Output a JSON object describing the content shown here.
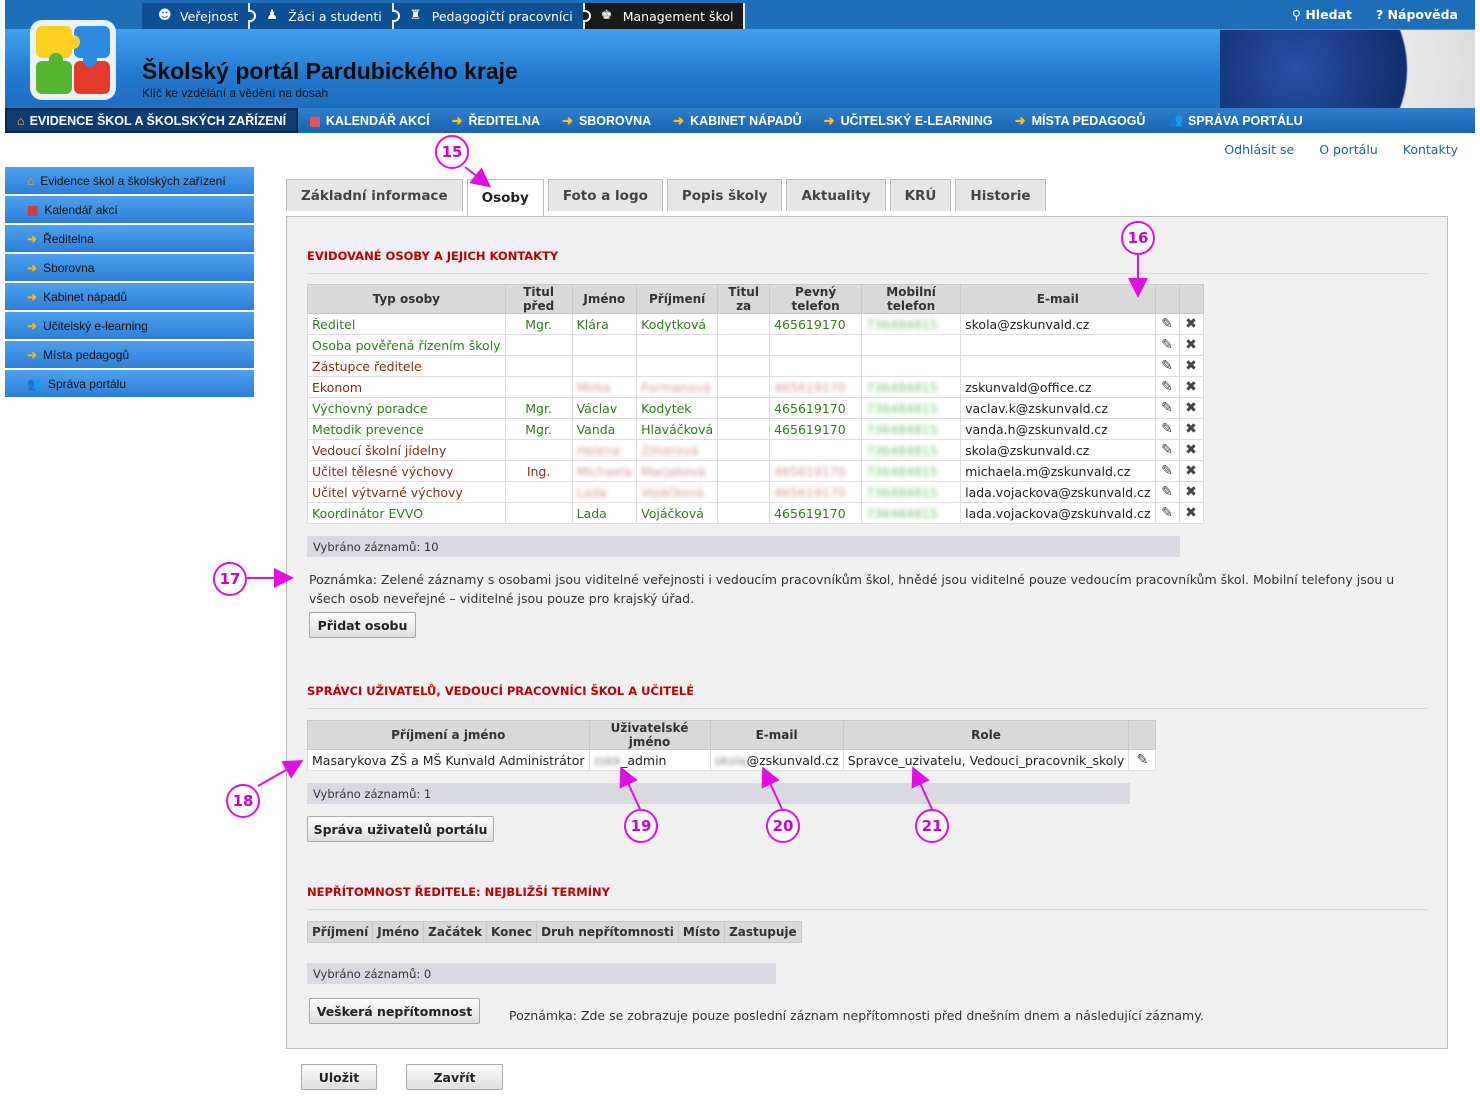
{
  "top": {
    "roles": [
      {
        "label": "Veřejnost",
        "icon": "people-icon"
      },
      {
        "label": "Žáci a studenti",
        "icon": "student-icon"
      },
      {
        "label": "Pedagogičtí pracovníci",
        "icon": "teacher-icon"
      },
      {
        "label": "Management škol",
        "icon": "manager-icon"
      }
    ],
    "search": "Hledat",
    "help": "Nápověda"
  },
  "banner": {
    "title": "Školský portál Pardubického kraje",
    "subtitle": "Klíč ke vzdělání a vědění na dosah"
  },
  "mainnav": [
    "EVIDENCE ŠKOL A ŠKOLSKÝCH ZAŘÍZENÍ",
    "KALENDÁŘ AKCÍ",
    "ŘEDITELNA",
    "SBOROVNA",
    "KABINET NÁPADŮ",
    "UČITELSKÝ E-LEARNING",
    "MÍSTA PEDAGOGŮ",
    "SPRÁVA PORTÁLU"
  ],
  "rightlinks": [
    "Odhlásit se",
    "O portálu",
    "Kontakty"
  ],
  "sidebar": [
    "Evidence škol a školských zařízení",
    "Kalendář akcí",
    "Ředitelna",
    "Sborovna",
    "Kabinet nápadů",
    "Učitelský e-learning",
    "Místa pedagogů",
    "Správa portálu"
  ],
  "tabs": [
    "Základní informace",
    "Osoby",
    "Foto a logo",
    "Popis školy",
    "Aktuality",
    "KRÚ",
    "Historie"
  ],
  "persons": {
    "title": "EVIDOVANÉ OSOBY A JEJICH KONTAKTY",
    "headers": [
      "Typ osoby",
      "Titul před",
      "Jméno",
      "Příjmení",
      "Titul za",
      "Pevný telefon",
      "Mobilní telefon",
      "E-mail"
    ],
    "rows": [
      {
        "type": "Ředitel",
        "tp": "Mgr.",
        "first": "Klára",
        "last": "Kodytková",
        "tz": "",
        "phone": "465619170",
        "mobile": "736484815",
        "email": "skola@zskunvald.cz",
        "color": "g"
      },
      {
        "type": "Osoba pověřená řízením školy",
        "tp": "",
        "first": "",
        "last": "",
        "tz": "",
        "phone": "",
        "mobile": "",
        "email": "",
        "color": "g"
      },
      {
        "type": "Zástupce ředitele",
        "tp": "",
        "first": "",
        "last": "",
        "tz": "",
        "phone": "",
        "mobile": "",
        "email": "",
        "color": "b"
      },
      {
        "type": "Ekonom",
        "tp": "",
        "first": "Mirka",
        "last": "Formanová",
        "tz": "",
        "phone": "465619170",
        "mobile": "736484815",
        "email": "zskunvald@office.cz",
        "color": "b"
      },
      {
        "type": "Výchovný poradce",
        "tp": "Mgr.",
        "first": "Václav",
        "last": "Kodytek",
        "tz": "",
        "phone": "465619170",
        "mobile": "736484815",
        "email": "vaclav.k@zskunvald.cz",
        "color": "g"
      },
      {
        "type": "Metodik prevence",
        "tp": "Mgr.",
        "first": "Vanda",
        "last": "Hlaváčková",
        "tz": "",
        "phone": "465619170",
        "mobile": "736484815",
        "email": "vanda.h@zskunvald.cz",
        "color": "g"
      },
      {
        "type": "Vedoucí školní jídelny",
        "tp": "",
        "first": "Helena",
        "last": "Zitterová",
        "tz": "",
        "phone": "",
        "mobile": "736484815",
        "email": "skola@zskunvald.cz",
        "color": "b"
      },
      {
        "type": "Učitel tělesné výchovy",
        "tp": "Ing.",
        "first": "Michaela",
        "last": "Marjaková",
        "tz": "",
        "phone": "465619170",
        "mobile": "736484815",
        "email": "michaela.m@zskunvald.cz",
        "color": "b"
      },
      {
        "type": "Učitel výtvarné výchovy",
        "tp": "",
        "first": "Lada",
        "last": "Vojáčková",
        "tz": "",
        "phone": "465619170",
        "mobile": "736484815",
        "email": "lada.vojackova@zskunvald.cz",
        "color": "b"
      },
      {
        "type": "Koordinátor EVVO",
        "tp": "",
        "first": "Lada",
        "last": "Vojáčková",
        "tz": "",
        "phone": "465619170",
        "mobile": "736484815",
        "email": "lada.vojackova@zskunvald.cz",
        "color": "g"
      }
    ],
    "count": "Vybráno záznamů: 10",
    "note": "Poznámka: Zelené záznamy s osobami jsou viditelné veřejnosti i vedoucím pracovníkům škol, hnědé jsou viditelné pouze vedoucím pracovníkům škol. Mobilní telefony jsou u všech osob neveřejné – viditelné jsou pouze pro krajský úřad.",
    "add": "Přidat osobu"
  },
  "admins": {
    "title": "SPRÁVCI UŽIVATELŮ, VEDOUCÍ PRACOVNÍCI ŠKOL A UČITELÉ",
    "headers": [
      "Příjmení a jméno",
      "Uživatelské jméno",
      "E-mail",
      "Role"
    ],
    "row": {
      "name": "Masarykova ZŠ a MŠ Kunvald Administrátor",
      "user_prefix": "zskk",
      "user": "_admin",
      "email_prefix": "skola",
      "email": "@zskunvald.cz",
      "role": "Spravce_uzivatelu, Vedouci_pracovnik_skoly"
    },
    "count": "Vybráno záznamů: 1",
    "manage": "Správa uživatelů portálu"
  },
  "absence": {
    "title": "NEPŘÍTOMNOST ŘEDITELE: NEJBLIŽŠÍ TERMÍNY",
    "headers": [
      "Příjmení",
      "Jméno",
      "Začátek",
      "Konec",
      "Druh nepřítomnosti",
      "Místo",
      "Zastupuje"
    ],
    "count": "Vybráno záznamů: 0",
    "all": "Veškerá nepřítomnost",
    "note": "Poznámka: Zde se zobrazuje pouze poslední záznam nepřítomnosti před dnešním dnem a následující záznamy."
  },
  "buttons": {
    "save": "Uložit",
    "close": "Zavřít"
  },
  "callouts": [
    "15",
    "16",
    "17",
    "18",
    "19",
    "20",
    "21"
  ],
  "colors": {
    "callout": "#e010e0",
    "green_record": "#2f7d1f",
    "brown_record": "#8a2c18",
    "section_title": "#c00000"
  }
}
